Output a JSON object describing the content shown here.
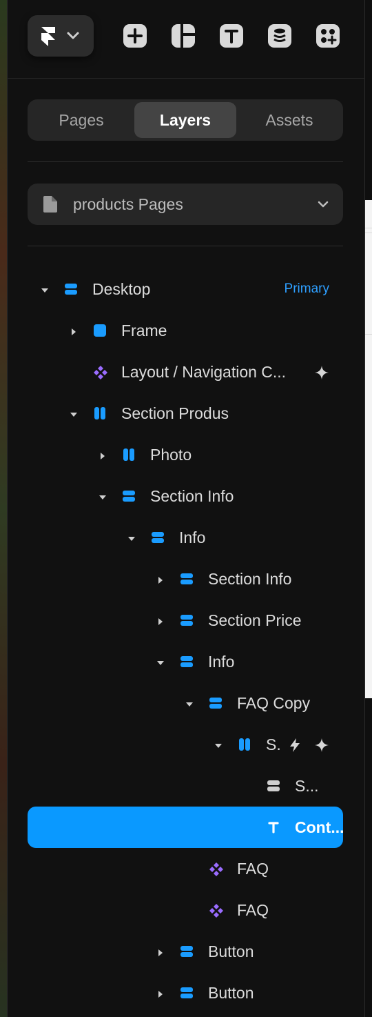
{
  "toolbar": {
    "logo_icon": "framer-logo-icon",
    "tools": [
      {
        "name": "insert-icon"
      },
      {
        "name": "layout-icon"
      },
      {
        "name": "text-icon"
      },
      {
        "name": "cms-icon"
      },
      {
        "name": "components-icon"
      }
    ]
  },
  "tabs": [
    {
      "label": "Pages",
      "active": false
    },
    {
      "label": "Layers",
      "active": true
    },
    {
      "label": "Assets",
      "active": false
    }
  ],
  "page_select": {
    "label": "products Pages",
    "icon": "page-icon"
  },
  "layers": [
    {
      "label": "Desktop",
      "badge": "Primary",
      "depth": 0,
      "toggle": "expanded",
      "icon": "stack"
    },
    {
      "label": "Frame",
      "depth": 1,
      "toggle": "collapsed",
      "icon": "frame"
    },
    {
      "label": "Layout / Navigation C...",
      "depth": 1,
      "toggle": "none",
      "icon": "component",
      "extra": "sparkle"
    },
    {
      "label": "Section Produs",
      "depth": 1,
      "toggle": "expanded",
      "icon": "columns"
    },
    {
      "label": "Photo",
      "depth": 2,
      "toggle": "collapsed",
      "icon": "columns"
    },
    {
      "label": "Section Info",
      "depth": 2,
      "toggle": "expanded",
      "icon": "stack"
    },
    {
      "label": "Info",
      "depth": 3,
      "toggle": "expanded",
      "icon": "stack"
    },
    {
      "label": "Section Info",
      "depth": 4,
      "toggle": "collapsed",
      "icon": "stack"
    },
    {
      "label": "Section Price",
      "depth": 4,
      "toggle": "collapsed",
      "icon": "stack"
    },
    {
      "label": "Info",
      "depth": 4,
      "toggle": "expanded",
      "icon": "stack"
    },
    {
      "label": "FAQ Copy",
      "depth": 5,
      "toggle": "expanded",
      "icon": "stack"
    },
    {
      "label": "S.",
      "depth": 6,
      "toggle": "expanded",
      "icon": "columns",
      "extra": "bolt-sparkle"
    },
    {
      "label": "S...",
      "depth": 7,
      "toggle": "none",
      "icon": "stack-gray"
    },
    {
      "label": "Cont...",
      "depth": 7,
      "toggle": "none",
      "icon": "text",
      "selected": true
    },
    {
      "label": "FAQ",
      "depth": 5,
      "toggle": "none",
      "icon": "component"
    },
    {
      "label": "FAQ",
      "depth": 5,
      "toggle": "none",
      "icon": "component"
    },
    {
      "label": "Button",
      "depth": 4,
      "toggle": "collapsed",
      "icon": "stack"
    },
    {
      "label": "Button",
      "depth": 4,
      "toggle": "collapsed",
      "icon": "stack"
    }
  ],
  "colors": {
    "accent": "#0a99ff",
    "frame_blue": "#1a9cff",
    "component_purple": "#9a6cff",
    "panel_bg": "#111111"
  }
}
